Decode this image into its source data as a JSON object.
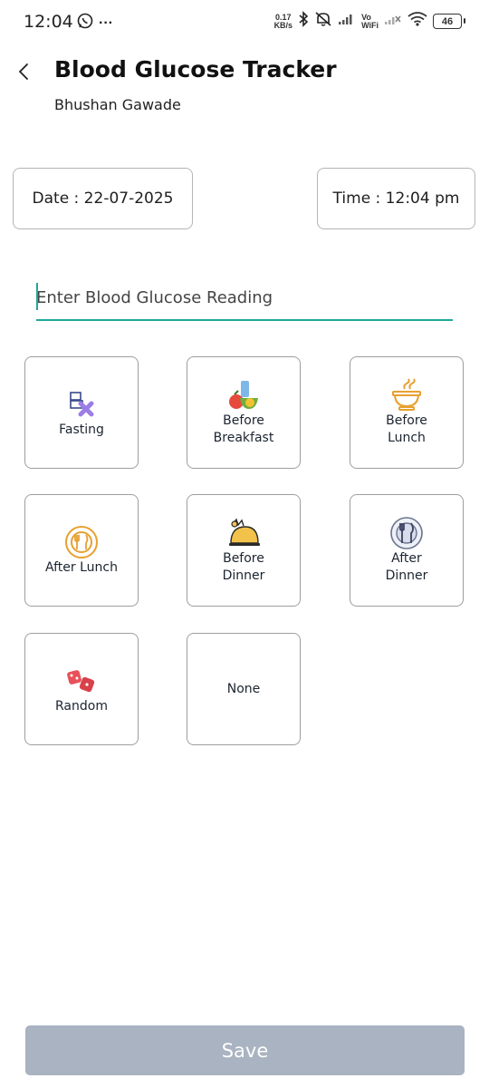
{
  "status_bar": {
    "time": "12:04",
    "more": "···",
    "net_speed_value": "0.17",
    "net_speed_unit": "KB/s",
    "vowifi_top": "Vo",
    "vowifi_bottom": "WiFi",
    "battery": "46"
  },
  "header": {
    "title": "Blood Glucose Tracker",
    "subtitle": "Bhushan Gawade"
  },
  "date_label": "Date : 22-07-2025",
  "time_label": "Time : 12:04 pm",
  "reading_input": {
    "placeholder": "Enter Blood Glucose Reading",
    "value": ""
  },
  "meal_options": [
    {
      "label": "Fasting",
      "icon": "fasting-icon"
    },
    {
      "label": "Before\nBreakfast",
      "icon": "breakfast-icon"
    },
    {
      "label": "Before\nLunch",
      "icon": "bowl-icon"
    },
    {
      "label": "After Lunch",
      "icon": "plate-icon"
    },
    {
      "label": "Before\nDinner",
      "icon": "dinner-icon"
    },
    {
      "label": "After\nDinner",
      "icon": "dinner-plate-icon"
    },
    {
      "label": "Random",
      "icon": "dice-icon"
    },
    {
      "label": "None",
      "icon": ""
    }
  ],
  "save_label": "Save",
  "colors": {
    "accent": "#1ea89a",
    "save_disabled": "#a9b3c1",
    "border": "#9e9e9e"
  }
}
